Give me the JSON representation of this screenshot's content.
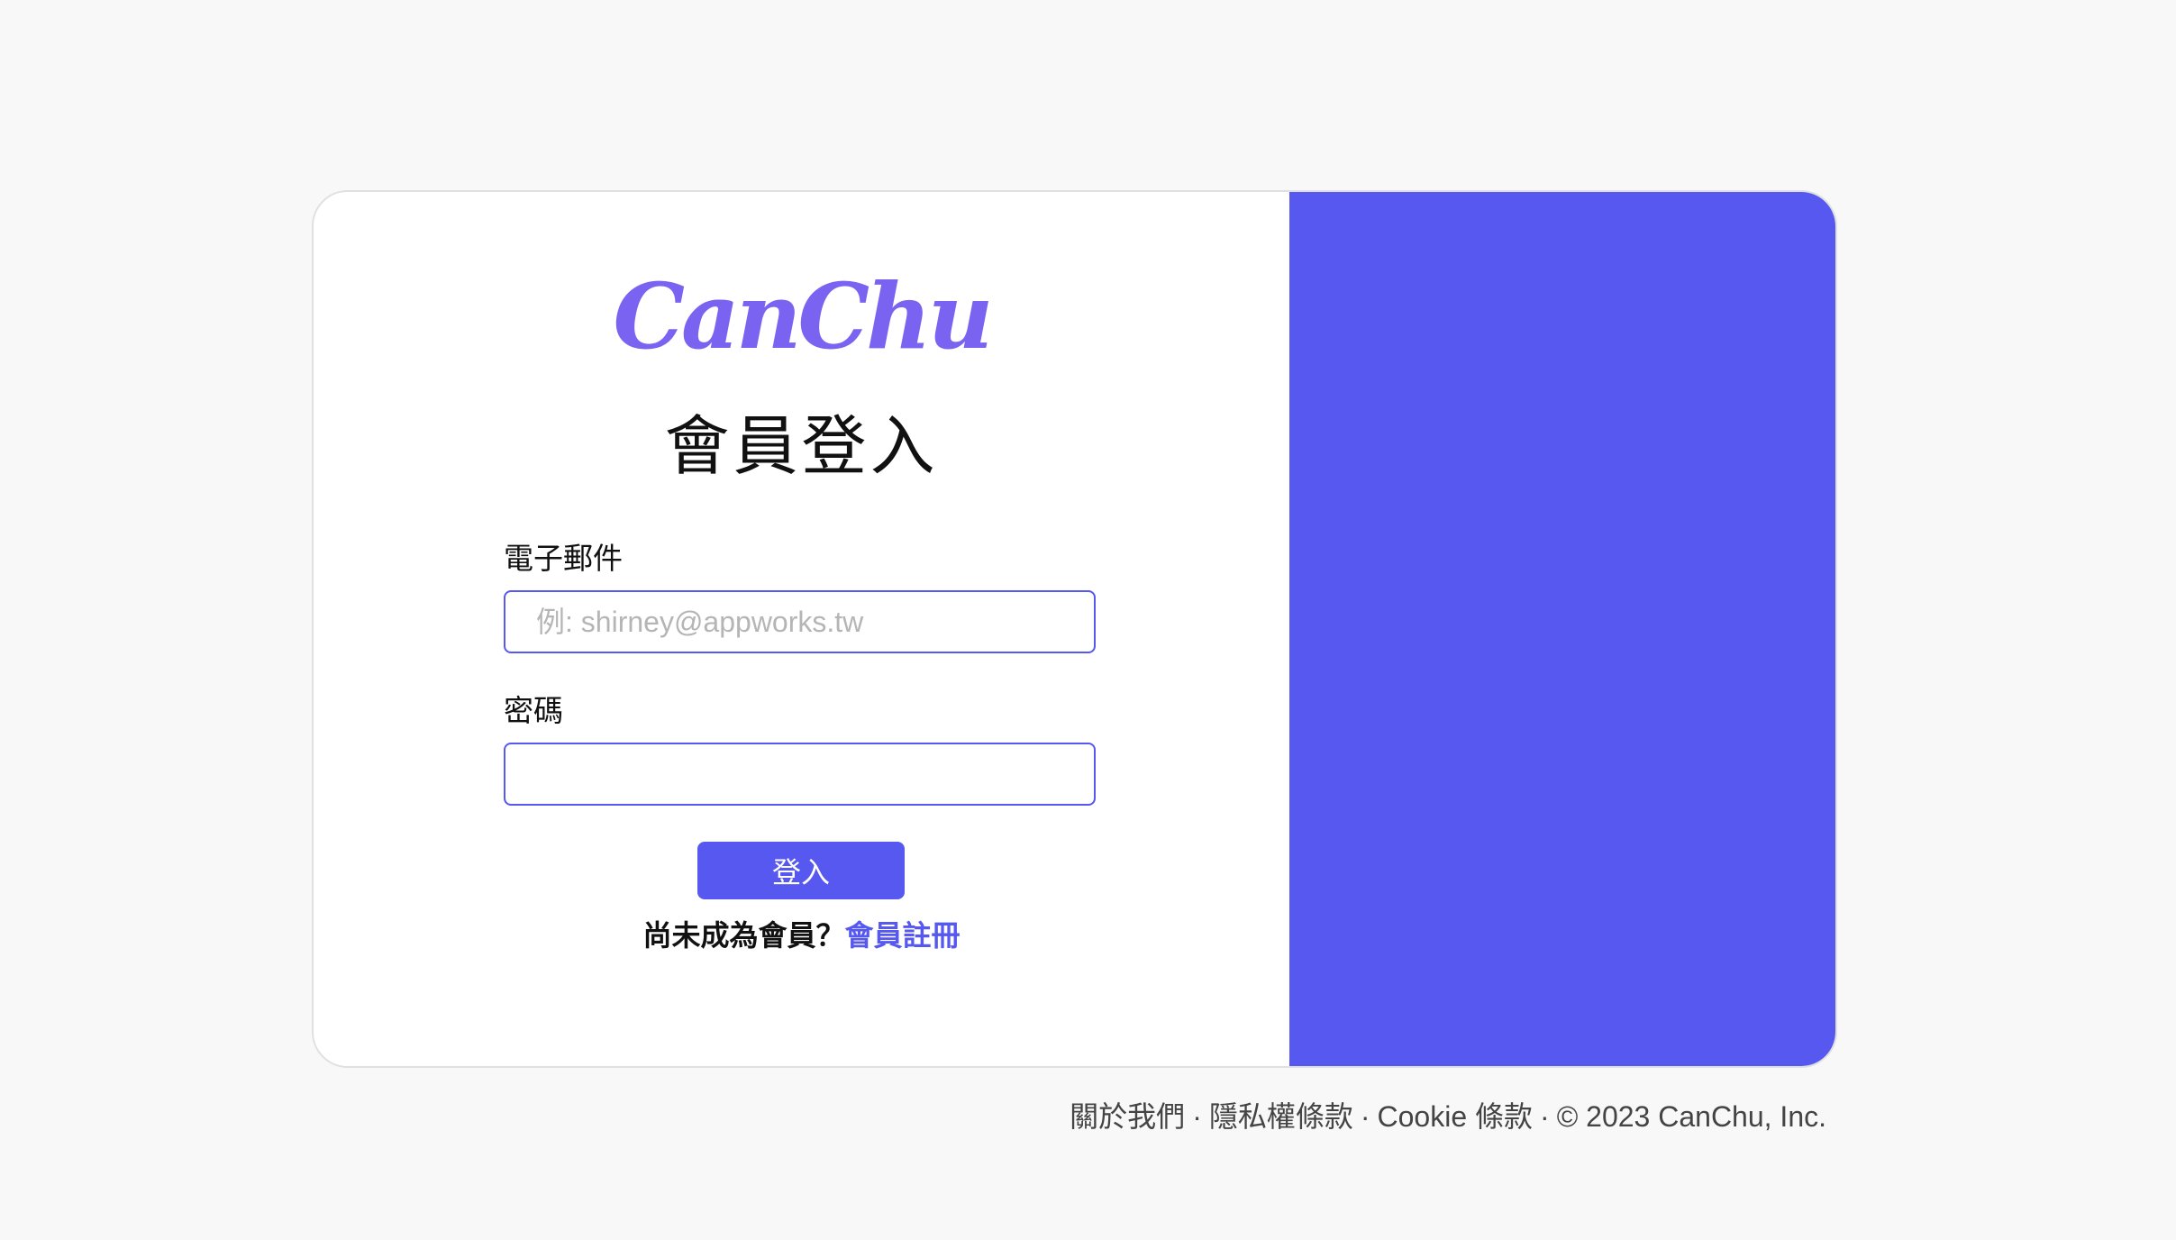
{
  "brand": {
    "logo": "CanChu"
  },
  "login": {
    "title": "會員登入",
    "email_label": "電子郵件",
    "email_placeholder": "例: shirney@appworks.tw",
    "email_value": "",
    "password_label": "密碼",
    "password_value": "",
    "submit_label": "登入",
    "signup_prompt": "尚未成為會員？",
    "signup_link": "會員註冊"
  },
  "footer": {
    "about": "關於我們",
    "privacy": "隱私權條款",
    "cookie": "Cookie 條款",
    "copyright": "© 2023 CanChu, Inc.",
    "separator": "·"
  },
  "colors": {
    "accent": "#5658f0",
    "logo": "#7a63f1",
    "background": "#f8f8f8",
    "card": "#ffffff"
  }
}
